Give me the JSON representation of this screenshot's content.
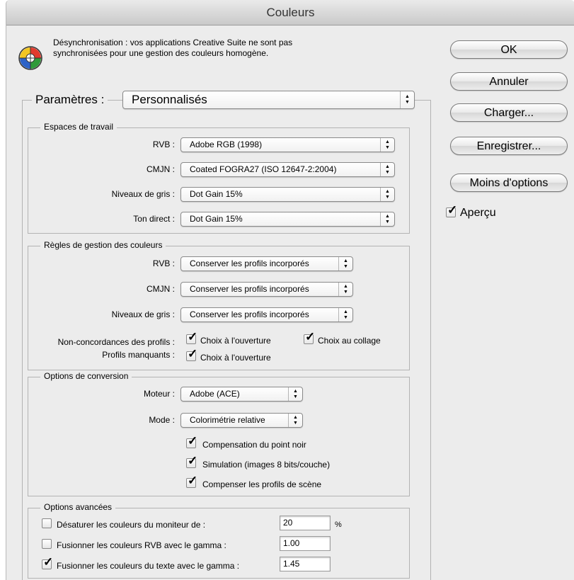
{
  "window": {
    "title": "Couleurs"
  },
  "message": {
    "line1": "Désynchronisation : vos applications Creative Suite ne sont pas",
    "line2": "synchronisées pour une gestion des couleurs homogène."
  },
  "buttons": {
    "ok": "OK",
    "cancel": "Annuler",
    "load": "Charger...",
    "save": "Enregistrer...",
    "fewer": "Moins d'options"
  },
  "preview": {
    "label": "Aperçu",
    "checked": true
  },
  "settings": {
    "label": "Paramètres :",
    "value": "Personnalisés"
  },
  "working_spaces": {
    "title": "Espaces de travail",
    "rgb_label": "RVB :",
    "rgb_value": "Adobe RGB (1998)",
    "cmyk_label": "CMJN :",
    "cmyk_value": "Coated FOGRA27 (ISO 12647-2:2004)",
    "gray_label": "Niveaux de gris :",
    "gray_value": "Dot Gain 15%",
    "spot_label": "Ton direct :",
    "spot_value": "Dot Gain 15%"
  },
  "policies": {
    "title": "Règles de gestion des couleurs",
    "rgb_label": "RVB :",
    "rgb_value": "Conserver les profils incorporés",
    "cmyk_label": "CMJN :",
    "cmyk_value": "Conserver les profils incorporés",
    "gray_label": "Niveaux de gris :",
    "gray_value": "Conserver les profils incorporés",
    "mismatch_label": "Non-concordances des profils :",
    "mismatch_open": "Choix à l'ouverture",
    "mismatch_paste": "Choix au collage",
    "missing_label": "Profils manquants :",
    "missing_open": "Choix à l'ouverture"
  },
  "conversion": {
    "title": "Options de conversion",
    "engine_label": "Moteur :",
    "engine_value": "Adobe (ACE)",
    "intent_label": "Mode :",
    "intent_value": "Colorimétrie relative",
    "bpc": "Compensation du point noir",
    "dither": "Simulation (images 8 bits/couche)",
    "scene": "Compenser les profils de scène"
  },
  "advanced": {
    "title": "Options avancées",
    "desaturate_label": "Désaturer les couleurs du moniteur de :",
    "desaturate_value": "20",
    "percent": "%",
    "blend_rgb_label": "Fusionner les couleurs RVB avec le gamma :",
    "blend_rgb_value": "1.00",
    "blend_text_label": "Fusionner les couleurs du texte avec le gamma :",
    "blend_text_value": "1.45"
  },
  "icons": {
    "arrows": "up-down-arrows-icon",
    "check": "checkmark-icon",
    "color-management": "color-management-icon"
  }
}
